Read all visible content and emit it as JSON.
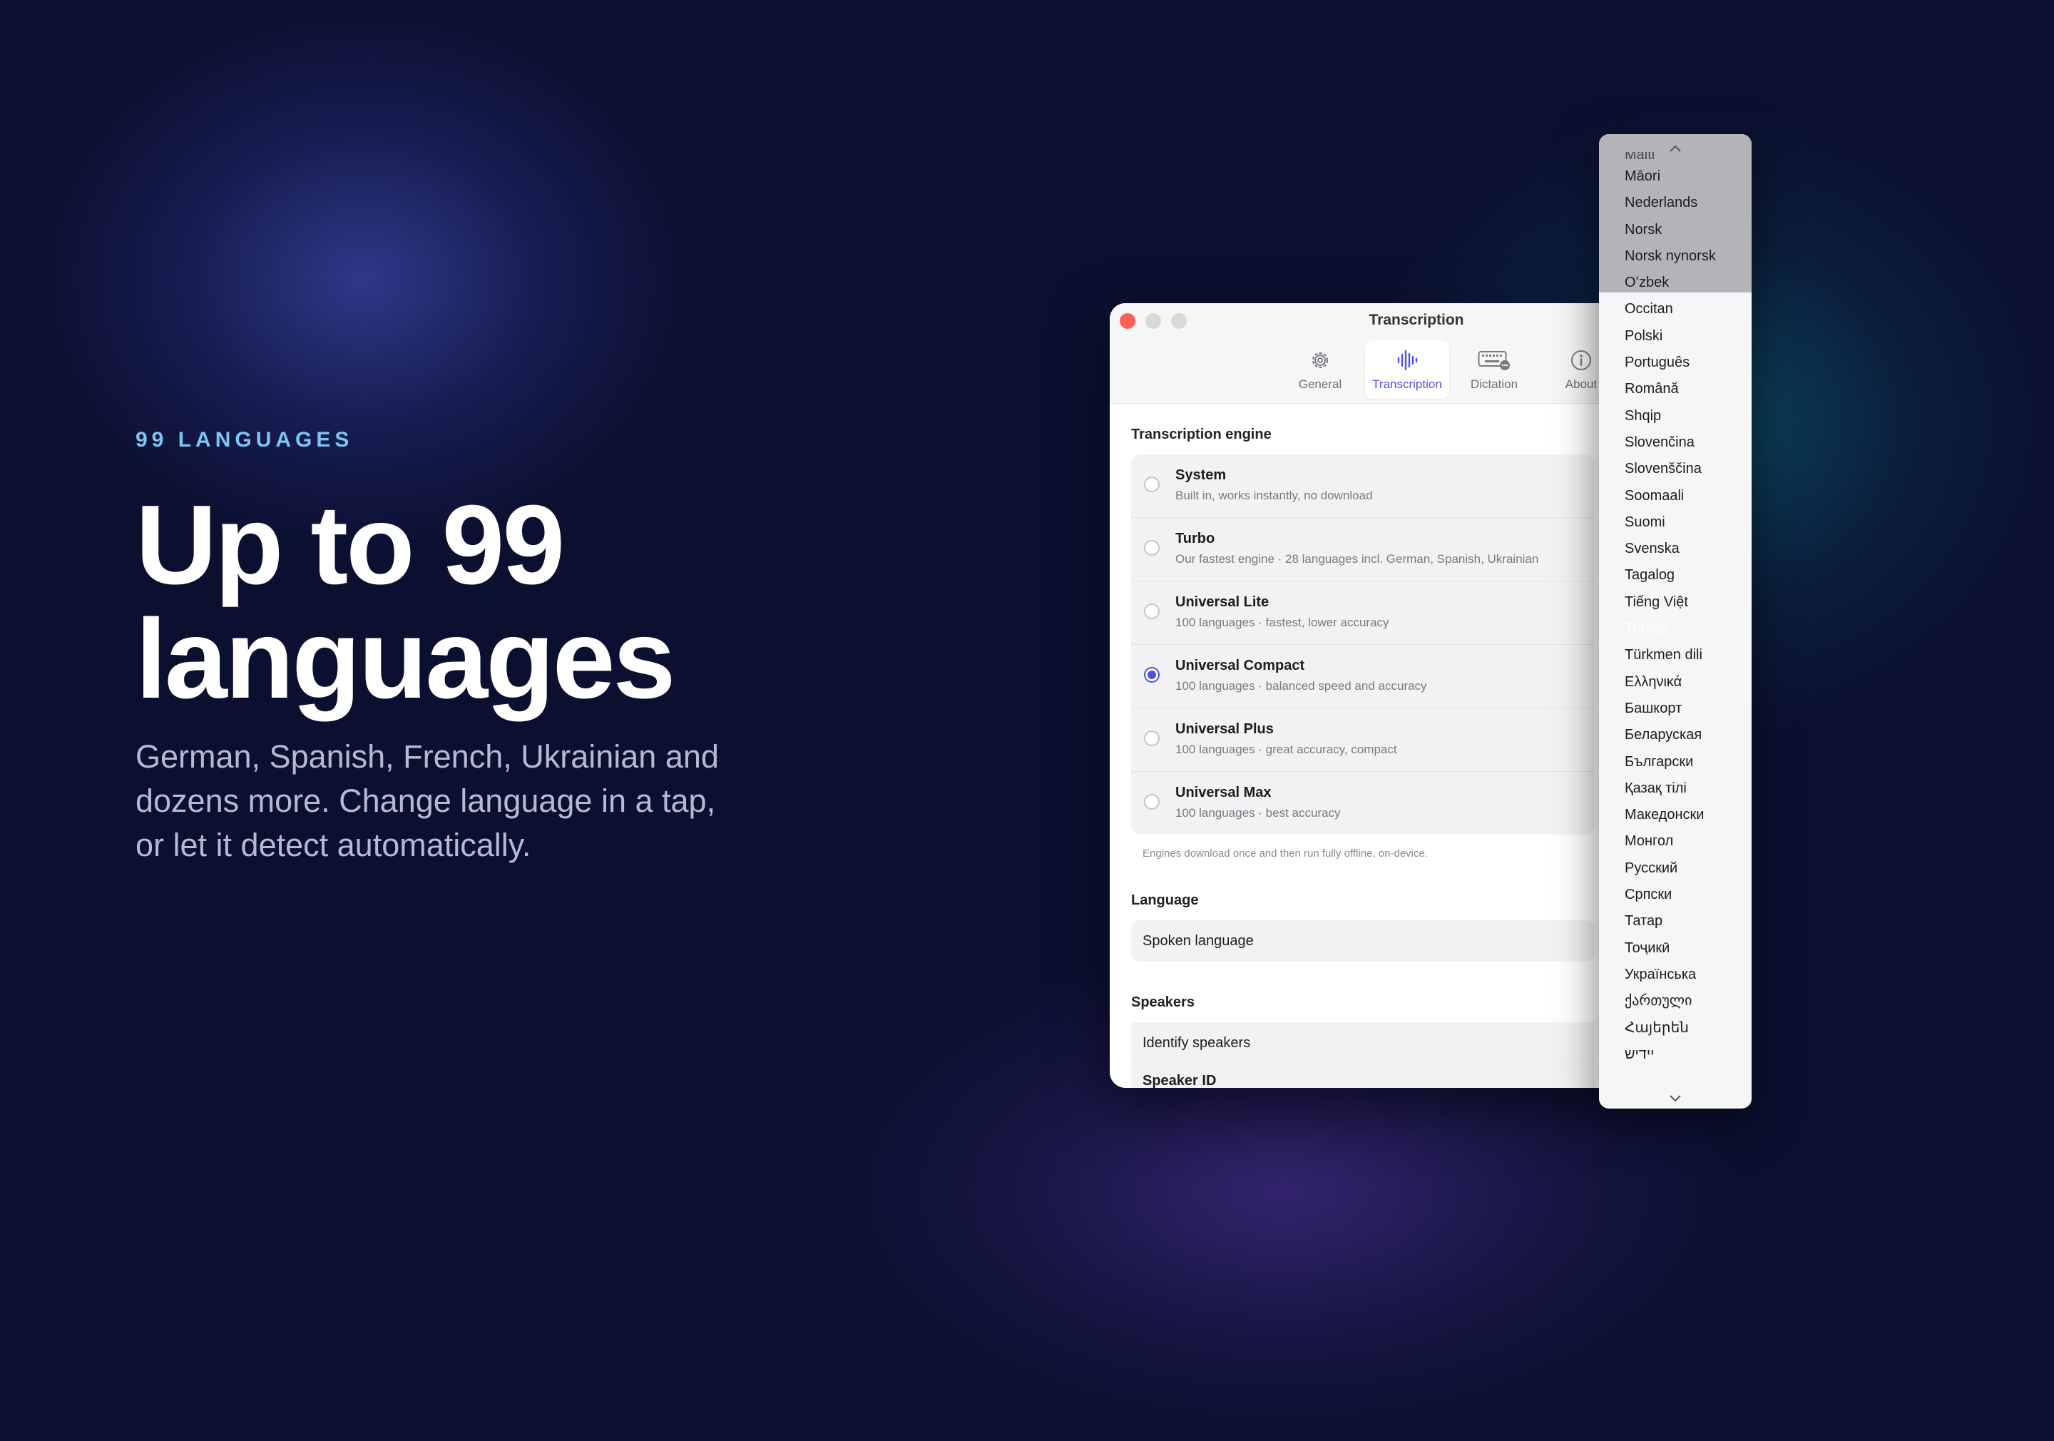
{
  "hero": {
    "eyebrow": "99 LANGUAGES",
    "headline_line1": "Up to 99",
    "headline_line2": "languages",
    "subtitle": "German, Spanish, French, Ukrainian and dozens more. Change language in a tap, or let it detect automatically."
  },
  "window": {
    "title": "Transcription",
    "tabs": [
      {
        "label": "General",
        "icon": "gear-icon"
      },
      {
        "label": "Transcription",
        "icon": "waveform-icon"
      },
      {
        "label": "Dictation",
        "icon": "keyboard-icon"
      },
      {
        "label": "About",
        "icon": "info-icon"
      }
    ],
    "active_tab": "Transcription",
    "accent": "#5050dc"
  },
  "engine": {
    "section_title": "Transcription engine",
    "options": [
      {
        "name": "System",
        "desc": "Built in, works instantly, no download",
        "selected": false
      },
      {
        "name": "Turbo",
        "desc": "Our fastest engine · 28 languages incl. German, Spanish, Ukrainian",
        "selected": false
      },
      {
        "name": "Universal Lite",
        "desc": "100 languages · fastest, lower accuracy",
        "selected": false
      },
      {
        "name": "Universal Compact",
        "desc": "100 languages · balanced speed and accuracy",
        "selected": true
      },
      {
        "name": "Universal Plus",
        "desc": "100 languages · great accuracy, compact",
        "selected": false
      },
      {
        "name": "Universal Max",
        "desc": "100 languages · best accuracy",
        "selected": false
      }
    ],
    "footnote": "Engines download once and then run fully offline, on-device."
  },
  "language": {
    "section_title": "Language",
    "row_label": "Spoken language"
  },
  "speakers": {
    "section_title": "Speakers",
    "row_label": "Identify speakers",
    "partial_label": "Speaker ID"
  },
  "language_menu": {
    "top_partial": "Malti",
    "items": [
      "Māori",
      "Nederlands",
      "Norsk",
      "Norsk nynorsk",
      "Oʻzbek",
      "Occitan",
      "Polski",
      "Português",
      "Română",
      "Shqip",
      "Slovenčina",
      "Slovenščina",
      "Soomaali",
      "Suomi",
      "Svenska",
      "Tagalog",
      "Tiếng Việt",
      "Türkçe",
      "Türkmen dili",
      "Ελληνικά",
      "Башкорт",
      "Беларуская",
      "Български",
      "Қазақ тілі",
      "Македонски",
      "Монгол",
      "Русский",
      "Српски",
      "Татар",
      "Тоҷикӣ",
      "Українська",
      "ქართული",
      "Հայերեն",
      "יידיש"
    ],
    "selected": "Türkçe",
    "scroll_up_icon": "chevron-up-icon",
    "scroll_down_icon": "chevron-down-icon",
    "highlight_color": "#5a4fd2"
  }
}
